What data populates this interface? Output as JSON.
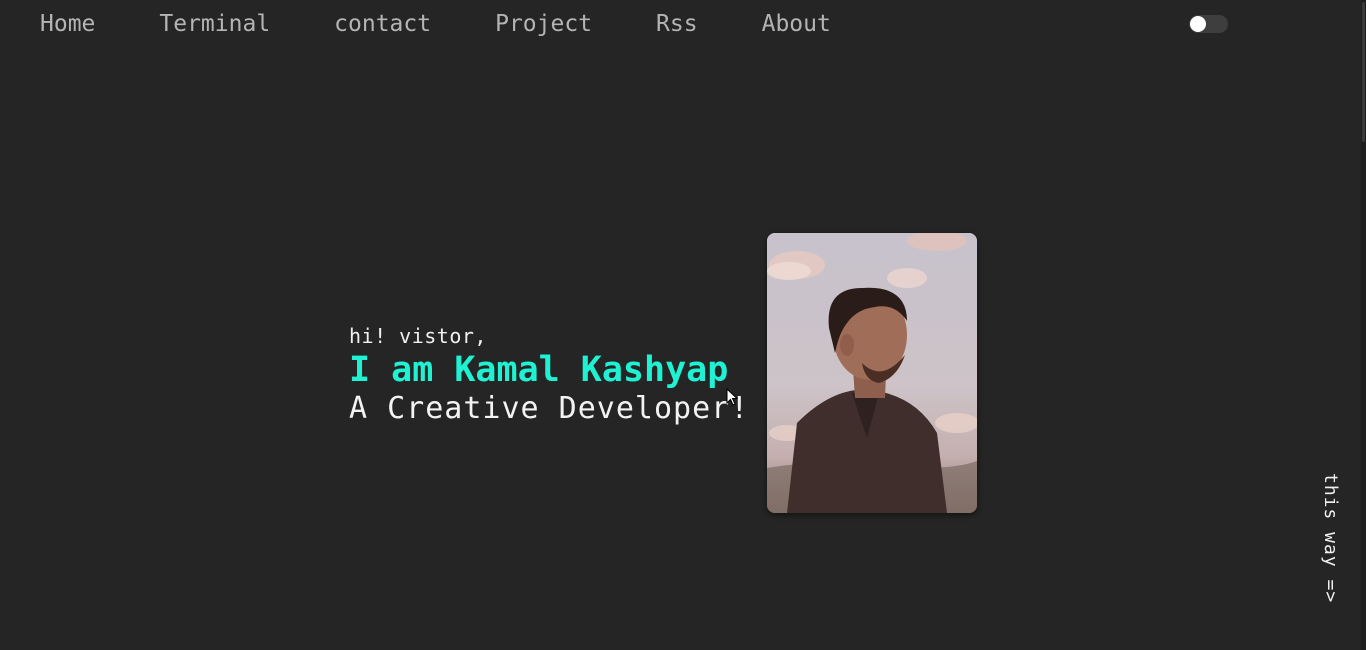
{
  "nav": {
    "items": [
      {
        "label": "Home"
      },
      {
        "label": "Terminal"
      },
      {
        "label": "contact"
      },
      {
        "label": "Project"
      },
      {
        "label": "Rss"
      },
      {
        "label": "About"
      }
    ]
  },
  "theme_toggle": {
    "state": "off"
  },
  "hero": {
    "greeting": "hi! vistor,",
    "name": "I am Kamal Kashyap",
    "role": "A Creative Developer!"
  },
  "side": {
    "hint": "this way =>"
  },
  "colors": {
    "background": "#252525",
    "accent": "#1ff2d3",
    "nav_text": "#b4b4b4"
  }
}
